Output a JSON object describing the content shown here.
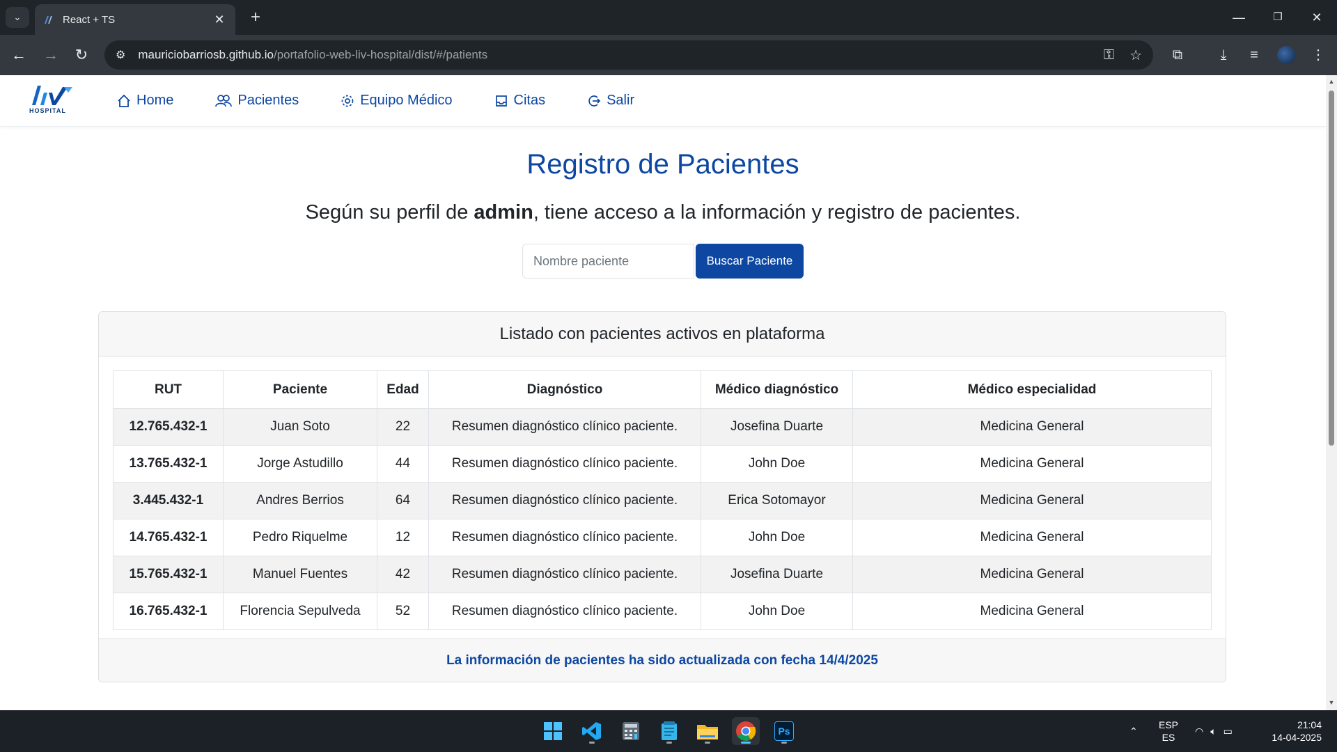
{
  "browser": {
    "tab_title": "React + TS",
    "tab_close": "✕",
    "new_tab": "+",
    "url_host": "mauriciobarriosb.github.io",
    "url_path": "/portafolio-web-liv-hospital/dist/#/patients",
    "window_controls": [
      "—",
      "❐",
      "✕"
    ]
  },
  "navbar": {
    "logo_text": "liv",
    "logo_subtitle": "HOSPITAL",
    "links": [
      {
        "label": "Home",
        "icon": "home-icon"
      },
      {
        "label": "Pacientes",
        "icon": "people-icon"
      },
      {
        "label": "Equipo Médico",
        "icon": "gear-icon"
      },
      {
        "label": "Citas",
        "icon": "inbox-icon"
      },
      {
        "label": "Salir",
        "icon": "logout-icon"
      }
    ]
  },
  "page": {
    "title": "Registro de Pacientes",
    "subtitle_before": "Según su perfil de ",
    "subtitle_role": "admin",
    "subtitle_after": ", tiene acceso a la información y registro de pacientes.",
    "search_placeholder": "Nombre paciente",
    "search_button": "Buscar Paciente"
  },
  "card": {
    "header": "Listado con pacientes activos en plataforma",
    "columns": [
      "RUT",
      "Paciente",
      "Edad",
      "Diagnóstico",
      "Médico diagnóstico",
      "Médico especialidad"
    ],
    "rows": [
      [
        "12.765.432-1",
        "Juan Soto",
        "22",
        "Resumen diagnóstico clínico paciente.",
        "Josefina Duarte",
        "Medicina General"
      ],
      [
        "13.765.432-1",
        "Jorge Astudillo",
        "44",
        "Resumen diagnóstico clínico paciente.",
        "John Doe",
        "Medicina General"
      ],
      [
        "3.445.432-1",
        "Andres Berrios",
        "64",
        "Resumen diagnóstico clínico paciente.",
        "Erica Sotomayor",
        "Medicina General"
      ],
      [
        "14.765.432-1",
        "Pedro Riquelme",
        "12",
        "Resumen diagnóstico clínico paciente.",
        "John Doe",
        "Medicina General"
      ],
      [
        "15.765.432-1",
        "Manuel Fuentes",
        "42",
        "Resumen diagnóstico clínico paciente.",
        "Josefina Duarte",
        "Medicina General"
      ],
      [
        "16.765.432-1",
        "Florencia Sepulveda",
        "52",
        "Resumen diagnóstico clínico paciente.",
        "John Doe",
        "Medicina General"
      ]
    ],
    "footer": "La información de pacientes ha sido actualizada con fecha 14/4/2025"
  },
  "taskbar": {
    "apps": [
      "windows-start-icon",
      "vscode-icon",
      "calculator-icon",
      "notepad-icon",
      "file-explorer-icon",
      "chrome-icon",
      "photoshop-icon"
    ],
    "photoshop_label": "Ps",
    "lang_top": "ESP",
    "lang_bottom": "ES",
    "time": "21:04",
    "date": "14-04-2025"
  },
  "colors": {
    "brand": "#0d47a1",
    "chrome_dark": "#1f2428",
    "chrome_toolbar": "#33393e"
  }
}
